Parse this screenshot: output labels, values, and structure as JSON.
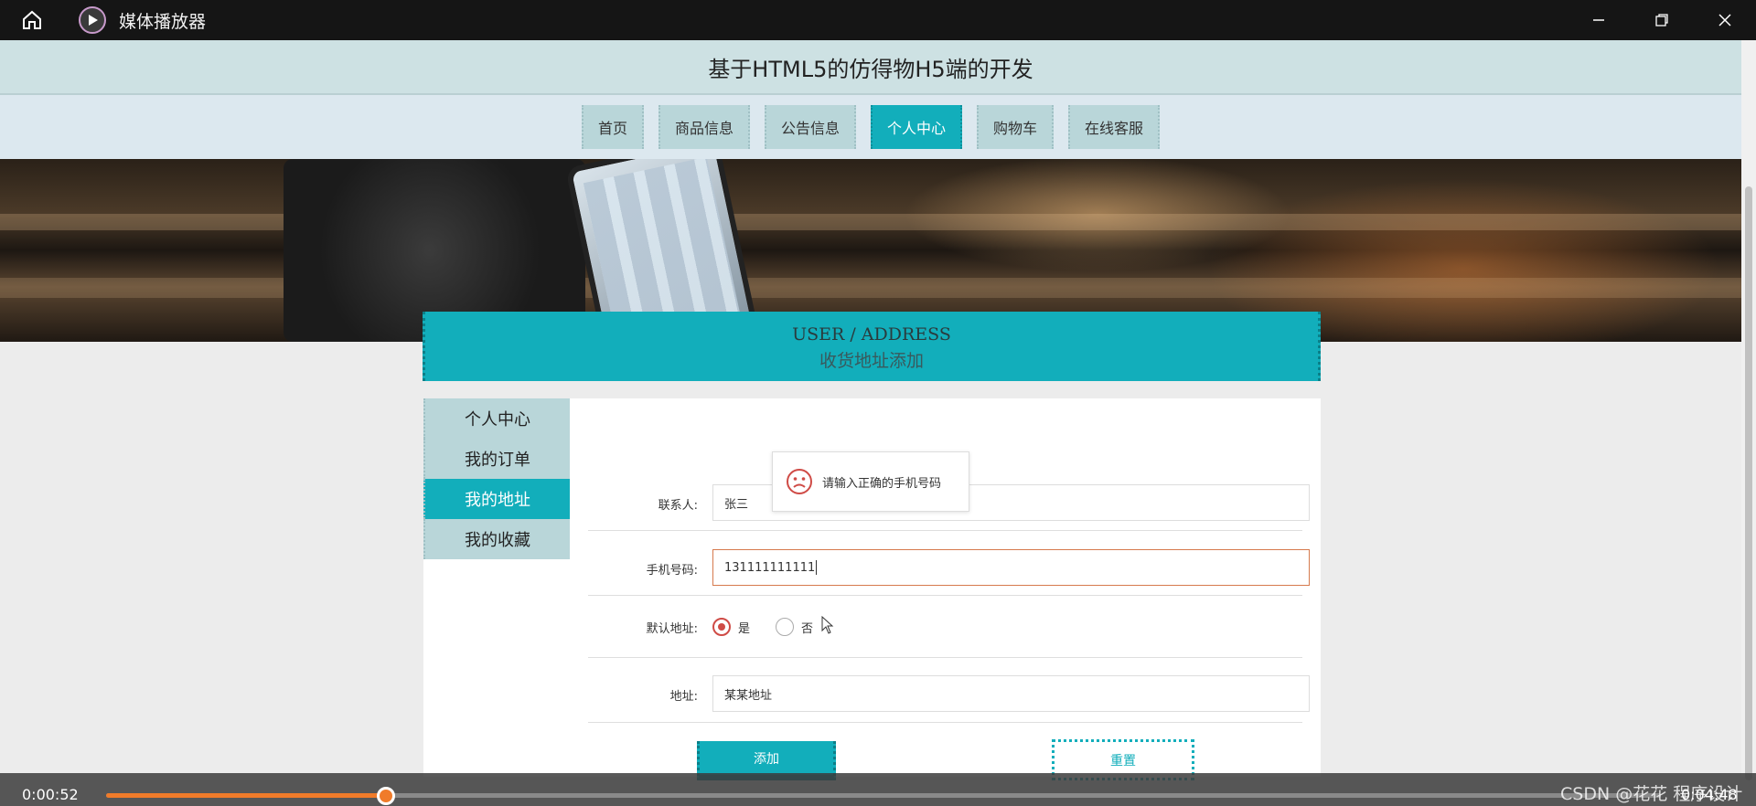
{
  "window": {
    "title": "媒体播放器",
    "controls": [
      "minimize-icon",
      "restore-icon",
      "close-icon"
    ]
  },
  "site": {
    "title": "基于HTML5的仿得物H5端的开发"
  },
  "nav": {
    "items": [
      {
        "label": "首页",
        "active": false
      },
      {
        "label": "商品信息",
        "active": false
      },
      {
        "label": "公告信息",
        "active": false
      },
      {
        "label": "个人中心",
        "active": true
      },
      {
        "label": "购物车",
        "active": false
      },
      {
        "label": "在线客服",
        "active": false
      }
    ]
  },
  "section": {
    "en": "USER / ADDRESS",
    "cn": "收货地址添加"
  },
  "sidebar": {
    "items": [
      {
        "label": "个人中心",
        "active": false
      },
      {
        "label": "我的订单",
        "active": false
      },
      {
        "label": "我的地址",
        "active": true
      },
      {
        "label": "我的收藏",
        "active": false
      }
    ]
  },
  "form": {
    "contact_label": "联系人:",
    "contact_value": "张三",
    "phone_label": "手机号码:",
    "phone_value": "131111111111",
    "default_label": "默认地址:",
    "default_yes": "是",
    "default_no": "否",
    "default_selected": "是",
    "address_label": "地址:",
    "address_value": "某某地址",
    "add_button": "添加",
    "reset_button": "重置"
  },
  "toast": {
    "message": "请输入正确的手机号码"
  },
  "player": {
    "current_time": "0:00:52",
    "total_time": "0:04:48",
    "progress": 0.18
  },
  "watermark": "CSDN @花花 程序设计",
  "colors": {
    "accent": "#12aebb",
    "progress": "#f07b2a",
    "error": "#cf4b46"
  }
}
